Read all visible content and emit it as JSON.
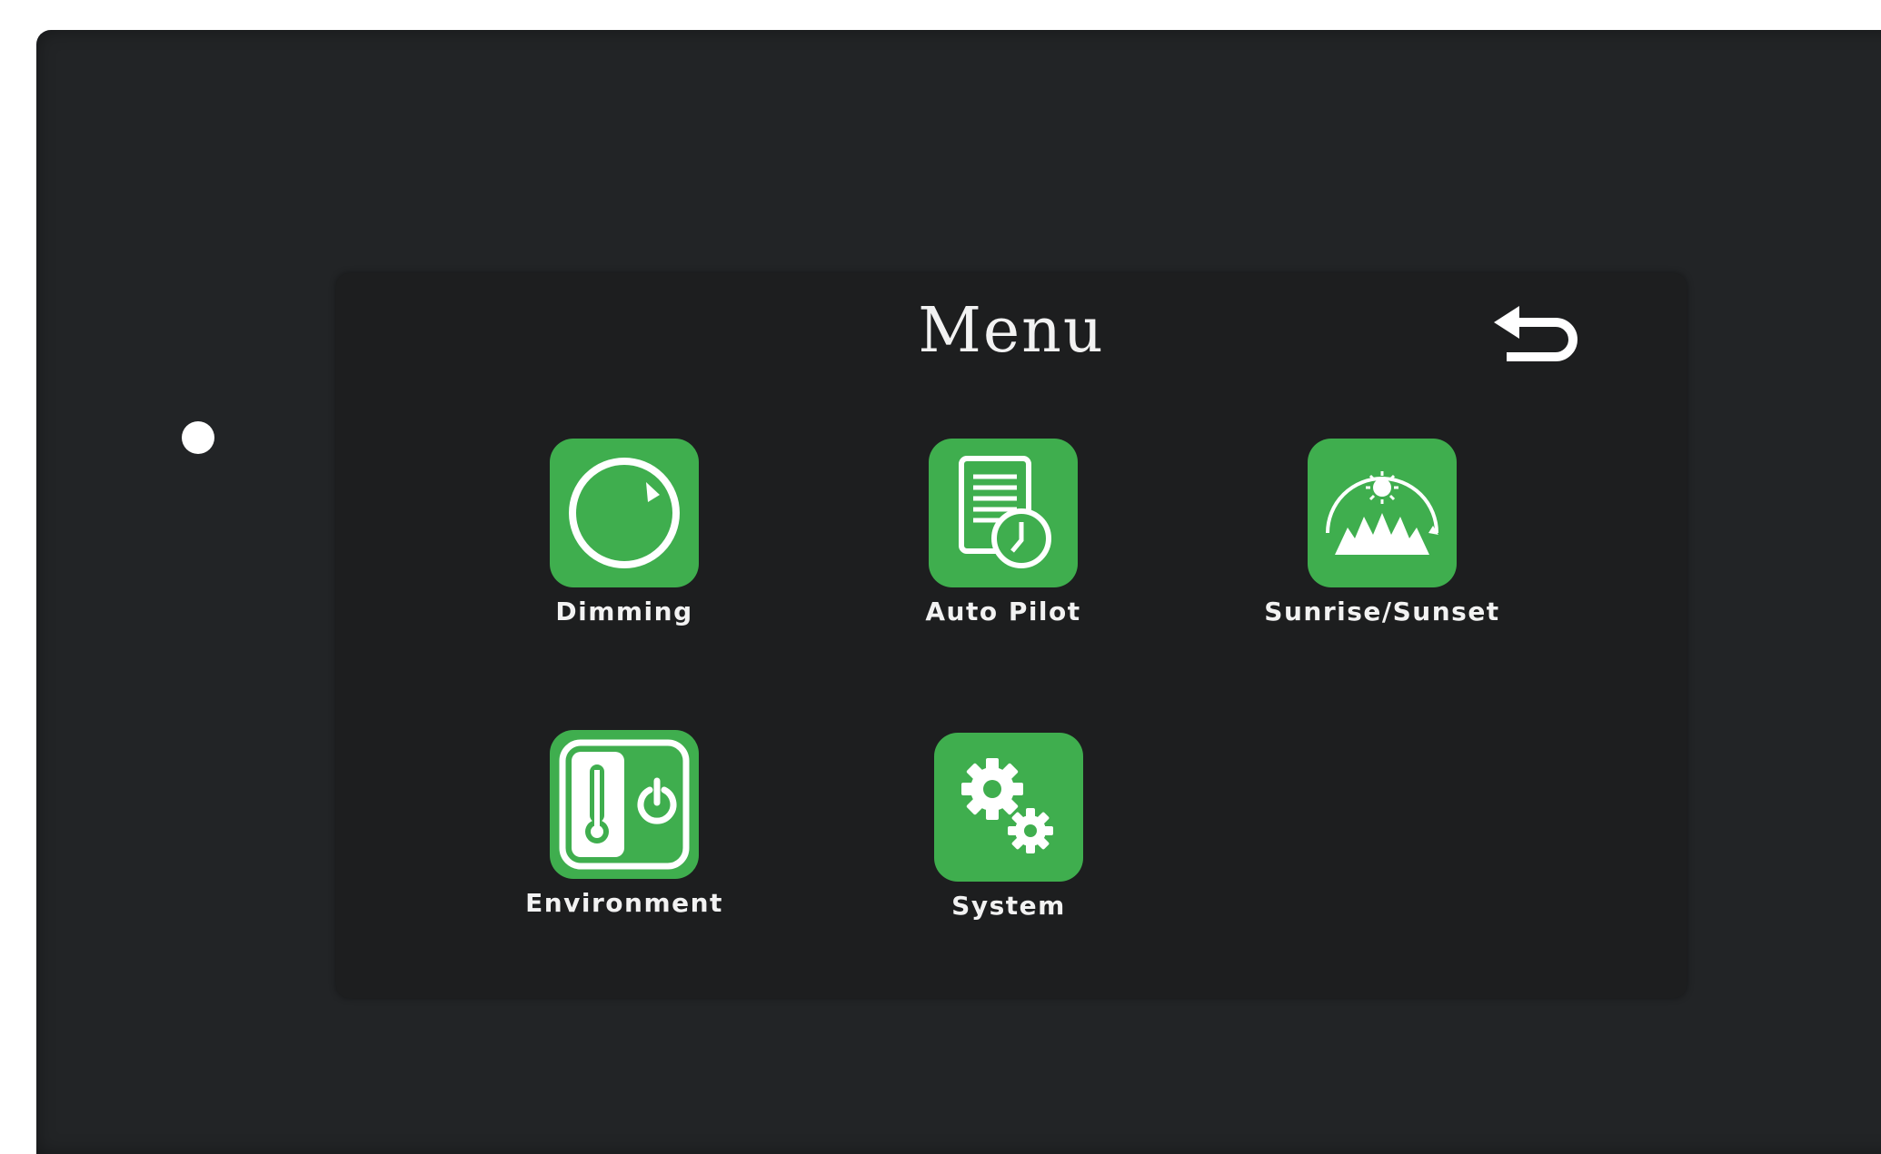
{
  "screen": {
    "title": "Menu",
    "back_icon": "back-arrow-icon"
  },
  "menu_items": [
    {
      "label": "Dimming",
      "icon": "dial-icon"
    },
    {
      "label": "Auto Pilot",
      "icon": "schedule-document-clock-icon"
    },
    {
      "label": "Sunrise/Sunset",
      "icon": "sun-over-landscape-icon"
    },
    {
      "label": "Environment",
      "icon": "thermometer-power-icon"
    },
    {
      "label": "System",
      "icon": "gears-icon"
    }
  ],
  "colors": {
    "device_bezel": "#222426",
    "screen_background": "#1d1e1f",
    "tile_green": "#3fae4e",
    "text": "#f2f2f2"
  }
}
